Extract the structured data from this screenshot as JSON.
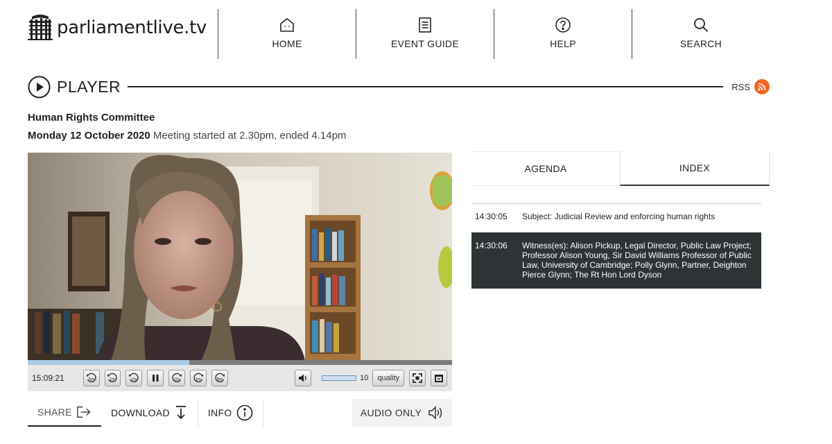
{
  "site": {
    "name": "parliamentlive.tv"
  },
  "nav": [
    {
      "label": "HOME",
      "icon": "home-icon"
    },
    {
      "label": "EVENT GUIDE",
      "icon": "document-icon"
    },
    {
      "label": "HELP",
      "icon": "help-icon"
    },
    {
      "label": "SEARCH",
      "icon": "search-icon"
    }
  ],
  "player": {
    "heading": "PLAYER",
    "rss_label": "RSS"
  },
  "meeting": {
    "title": "Human Rights Committee",
    "date": "Monday 12 October 2020",
    "times": " Meeting started at 2.30pm, ended 4.14pm"
  },
  "video": {
    "progress": 0.38,
    "timecode": "15:09:21",
    "skip_back": [
      "5m",
      "1m",
      "10s"
    ],
    "skip_forward": [
      "10s",
      "1m",
      "5m"
    ],
    "volume": "10",
    "quality_label": "quality"
  },
  "actions": {
    "share": "SHARE",
    "download": "DOWNLOAD",
    "info": "INFO",
    "audio_only": "AUDIO ONLY"
  },
  "tabs": {
    "agenda": "AGENDA",
    "index": "INDEX"
  },
  "index": [
    {
      "time": "14:30:05",
      "text": "Subject: Judicial Review and enforcing human rights"
    },
    {
      "time": "14:30:06",
      "text": "Witness(es): Alison Pickup, Legal Director, Public Law Project; Professor Alison Young, Sir David Williams Professor of Public Law, University of Cambridge; Polly Glynn, Partner, Deighton Pierce Glynn; The Rt Hon Lord Dyson"
    }
  ],
  "colors": {
    "rss": "#f26522",
    "active_row": "#2e3436",
    "progress": "#a9cbe6"
  }
}
